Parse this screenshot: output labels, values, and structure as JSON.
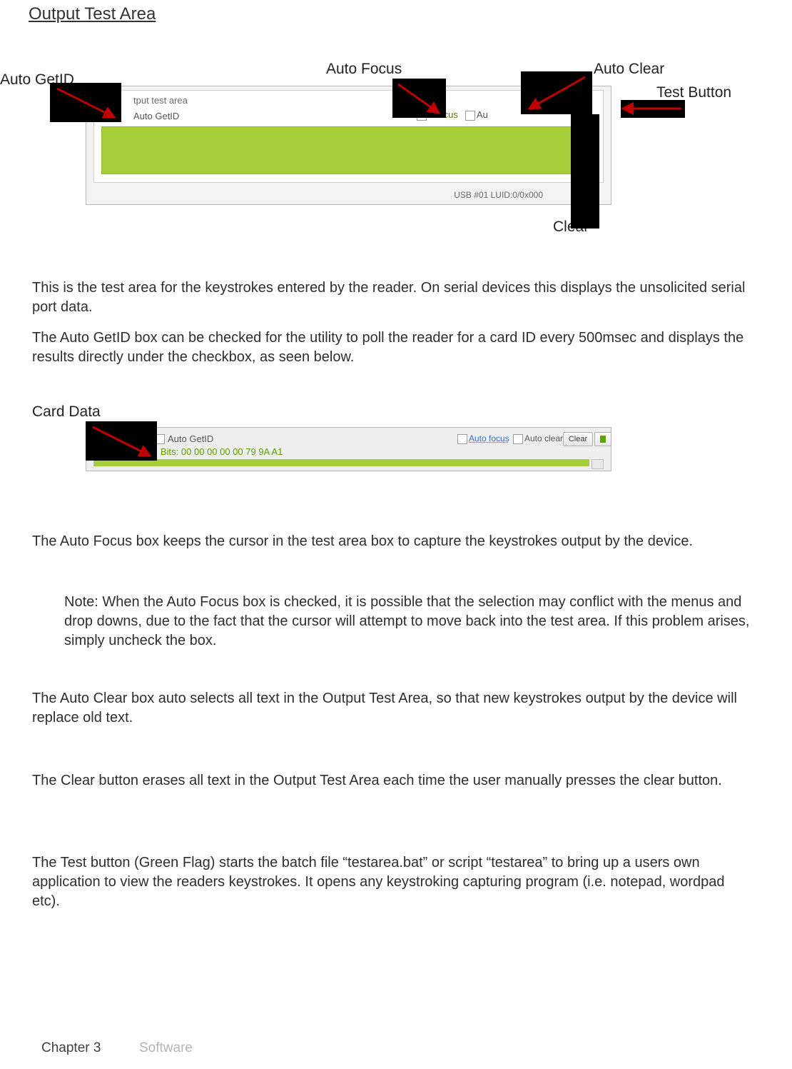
{
  "title": "Output Test Area",
  "callouts": {
    "autoGetID": "Auto GetID",
    "autoFocus": "Auto Focus",
    "autoClear": "Auto Clear",
    "testButton": "Test Button",
    "clear": "Clear",
    "cardData": "Card Data"
  },
  "shot1": {
    "label1": "tput test area",
    "label2": "Auto GetID",
    "afLabel": "o focus",
    "acLabel": "Au",
    "status": "USB #01 LUID:0/0x000"
  },
  "shot2": {
    "getid": "Auto GetID",
    "af": "Auto focus",
    "ac": "Auto clear",
    "clear": "Clear",
    "bits": "Bits: 00 00 00 00 00 79 9A A1"
  },
  "paras": {
    "p1": "This is the test area for the keystrokes entered by the reader. On serial devices this displays the unsolicited serial port data.",
    "p2": "The Auto GetID box can be checked for the utility to poll the reader for a card ID every 500msec and displays the results directly under the checkbox, as seen below.",
    "p3": "The Auto Focus box keeps the cursor in the test area box to capture the keystrokes output by the device.",
    "p4": "Note: When the Auto Focus box is checked, it is possible that the selection may conflict with the menus and drop downs, due to the fact that the cursor will attempt to move back into the test area. If this problem arises, simply uncheck the box.",
    "p5": "The Auto Clear box auto selects all text in the Output Test Area, so that new keystrokes output by the device will replace old text.",
    "p6": "The Clear button erases all text in the Output Test Area each time the user manually presses the clear button.",
    "p7": "The Test button (Green Flag) starts the batch file “testarea.bat” or script “testarea” to bring up a users own application to view the readers keystrokes. It opens any keystroking capturing program (i.e. notepad, wordpad etc)."
  },
  "footer": {
    "chapter": "Chapter 3",
    "section": "Software"
  }
}
